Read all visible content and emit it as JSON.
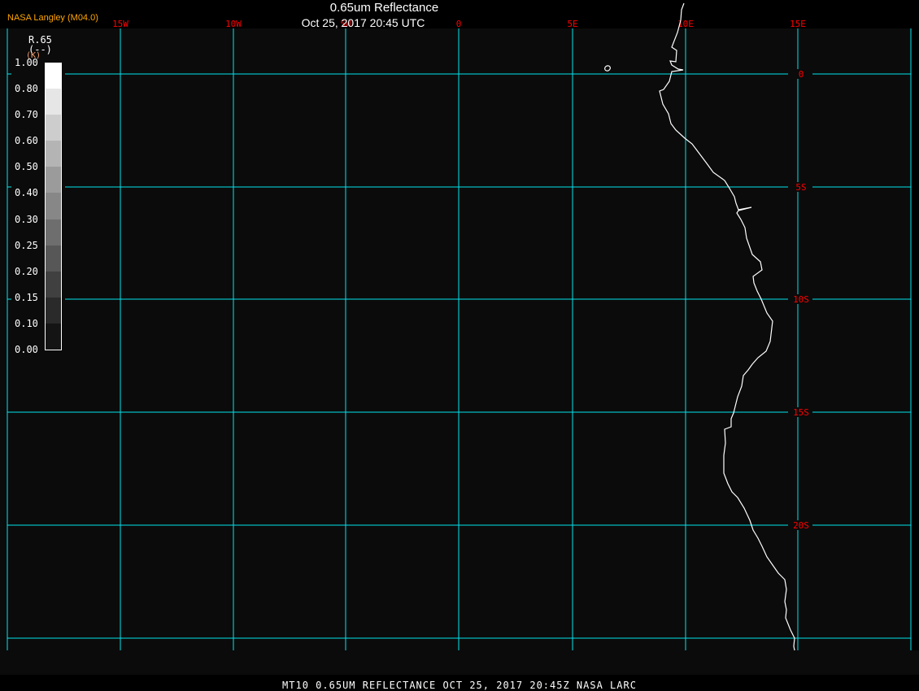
{
  "header": {
    "title": "0.65um Reflectance",
    "subtitle": "Oct 25, 2017 20:45 UTC",
    "credit": "NASA Langley (M04.0)"
  },
  "legend": {
    "variable": "R.65",
    "units": "(--)",
    "units_alt": "(K)",
    "ticks": [
      "1.00",
      "0.80",
      "0.70",
      "0.60",
      "0.50",
      "0.40",
      "0.30",
      "0.25",
      "0.20",
      "0.15",
      "0.10",
      "0.00"
    ],
    "band_colors": [
      "#ffffff",
      "#e6e6e6",
      "#cdcdcd",
      "#b4b4b4",
      "#9b9b9b",
      "#878787",
      "#6e6e6e",
      "#575757",
      "#404040",
      "#2a2a2a",
      "#141414"
    ]
  },
  "map": {
    "longitude_labels": [
      "15W",
      "10W",
      "5W",
      "0",
      "5E",
      "10E",
      "15E"
    ],
    "latitude_labels": [
      "0",
      "5S",
      "10S",
      "15S",
      "20S"
    ],
    "grid_color": "#00e5ee",
    "label_color": "#ff0000",
    "coastline_color": "#ffffff",
    "background_color": "#0b0b0b"
  },
  "footer": {
    "text": "MT10  0.65UM REFLECTANCE   OCT 25, 2017 20:45Z   NASA LARC"
  }
}
